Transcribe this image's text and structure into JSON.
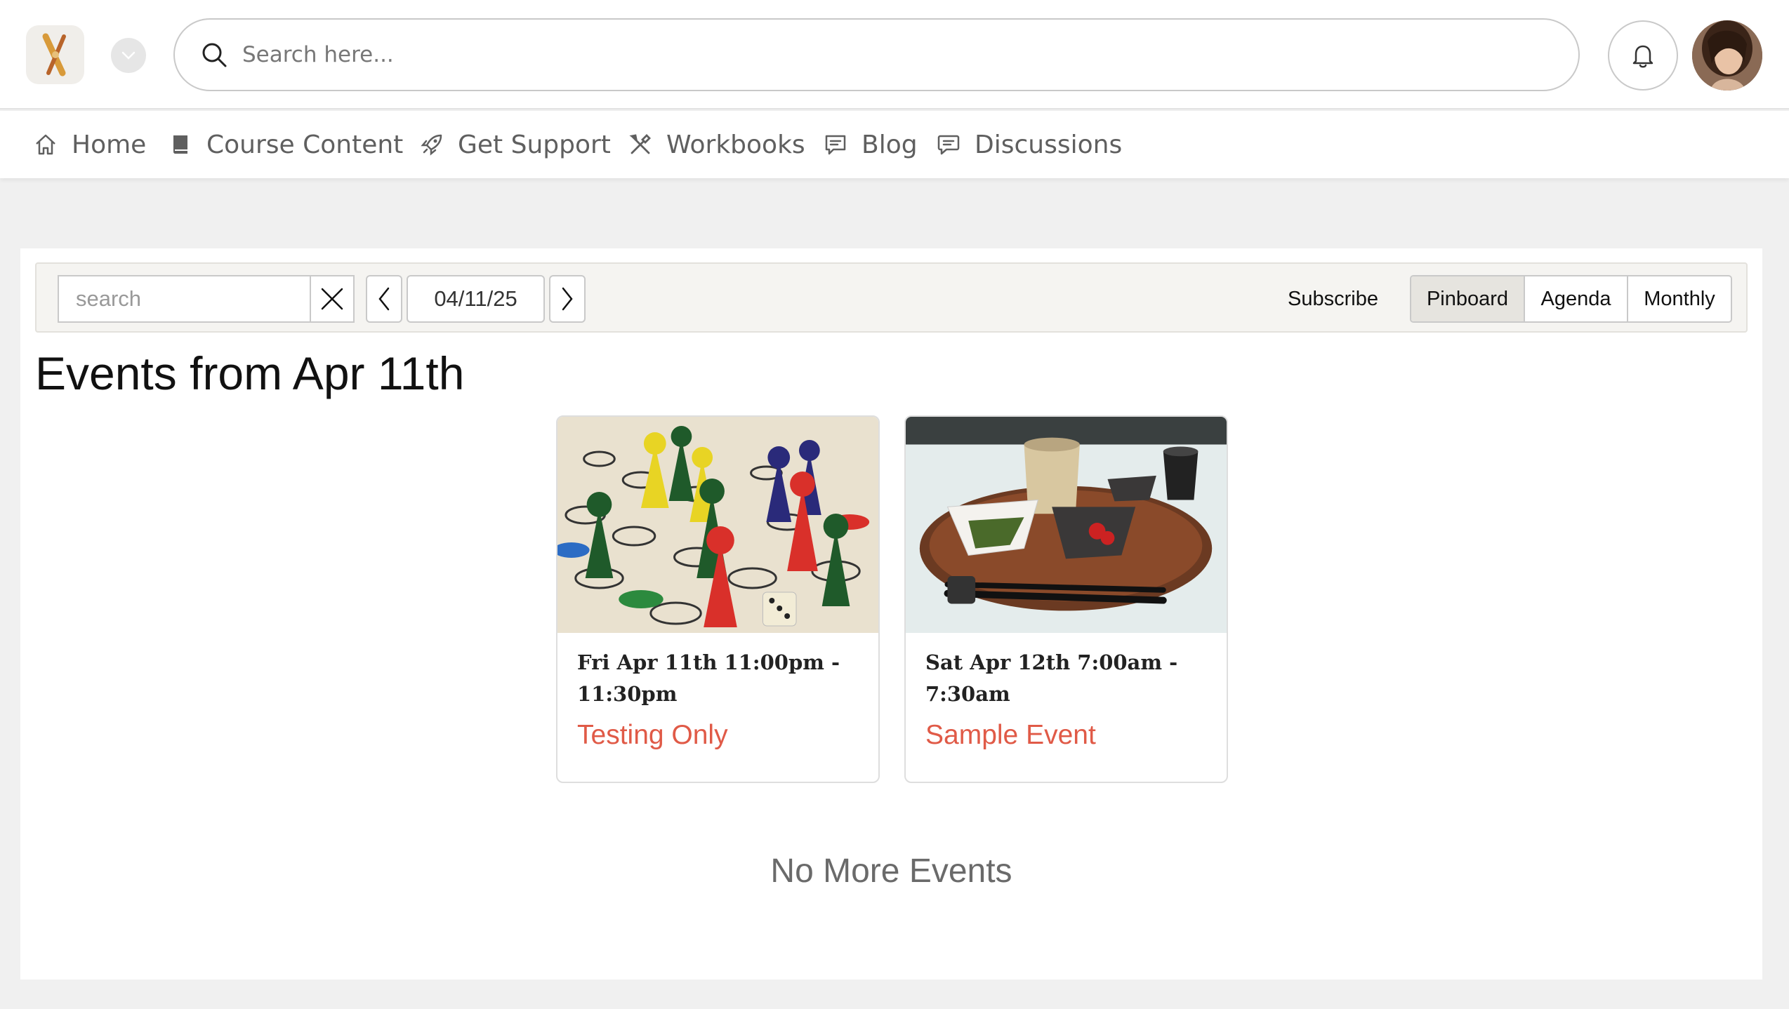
{
  "header": {
    "search_placeholder": "Search here..."
  },
  "nav": {
    "items": [
      {
        "label": "Home",
        "icon": "home-icon"
      },
      {
        "label": "Course Content",
        "icon": "book-icon"
      },
      {
        "label": "Get Support",
        "icon": "rocket-icon"
      },
      {
        "label": "Workbooks",
        "icon": "tools-icon"
      },
      {
        "label": "Blog",
        "icon": "blog-icon"
      },
      {
        "label": "Discussions",
        "icon": "chat-icon"
      }
    ]
  },
  "calendar": {
    "search_placeholder": "search",
    "date": "04/11/25",
    "subscribe_label": "Subscribe",
    "views": [
      "Pinboard",
      "Agenda",
      "Monthly"
    ],
    "active_view": "Pinboard",
    "heading": "Events from Apr 11th",
    "events": [
      {
        "time": "Fri Apr 11th 11:00pm - 11:30pm",
        "title": "Testing Only",
        "image": "board-game-pawns"
      },
      {
        "time": "Sat Apr 12th 7:00am - 7:30am",
        "title": "Sample Event",
        "image": "japanese-tea-tray"
      }
    ],
    "no_more_label": "No More Events"
  },
  "colors": {
    "accent": "#e05a47",
    "page_bg": "#f0f0f0",
    "toolbar_bg": "#f5f4f1"
  }
}
